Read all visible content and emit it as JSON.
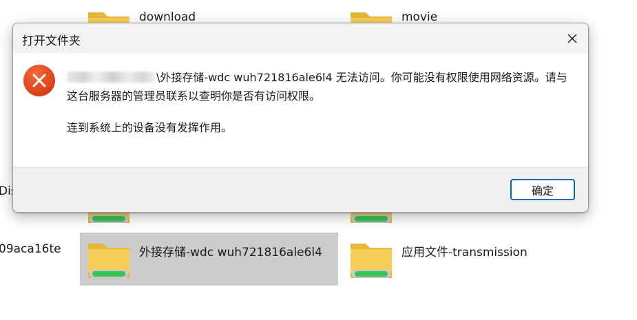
{
  "background": {
    "items": [
      {
        "label": "download"
      },
      {
        "label": "movie"
      },
      {
        "label": "Dis"
      },
      {
        "label": "09aca16te"
      },
      {
        "label": "外接存储-wdc wuh721816ale6l4"
      },
      {
        "label": "应用文件-transmission"
      }
    ]
  },
  "dialog": {
    "title": "打开文件夹",
    "message_line1_suffix": "\\外接存储-wdc wuh721816ale6l4 无法访问。你可能没有权限使用网络资源。请与这台服务器的管理员联系以查明你是否有访问权限。",
    "message_prefix": "\\",
    "message_line2": "连到系统上的设备没有发挥作用。",
    "ok_label": "确定",
    "icon": "error-icon",
    "close_icon": "close-icon"
  },
  "colors": {
    "error_red": "#d83b01",
    "accent_blue": "#0067c0",
    "folder_yellow": "#f2c94c",
    "drive_green": "#3cc25a"
  }
}
